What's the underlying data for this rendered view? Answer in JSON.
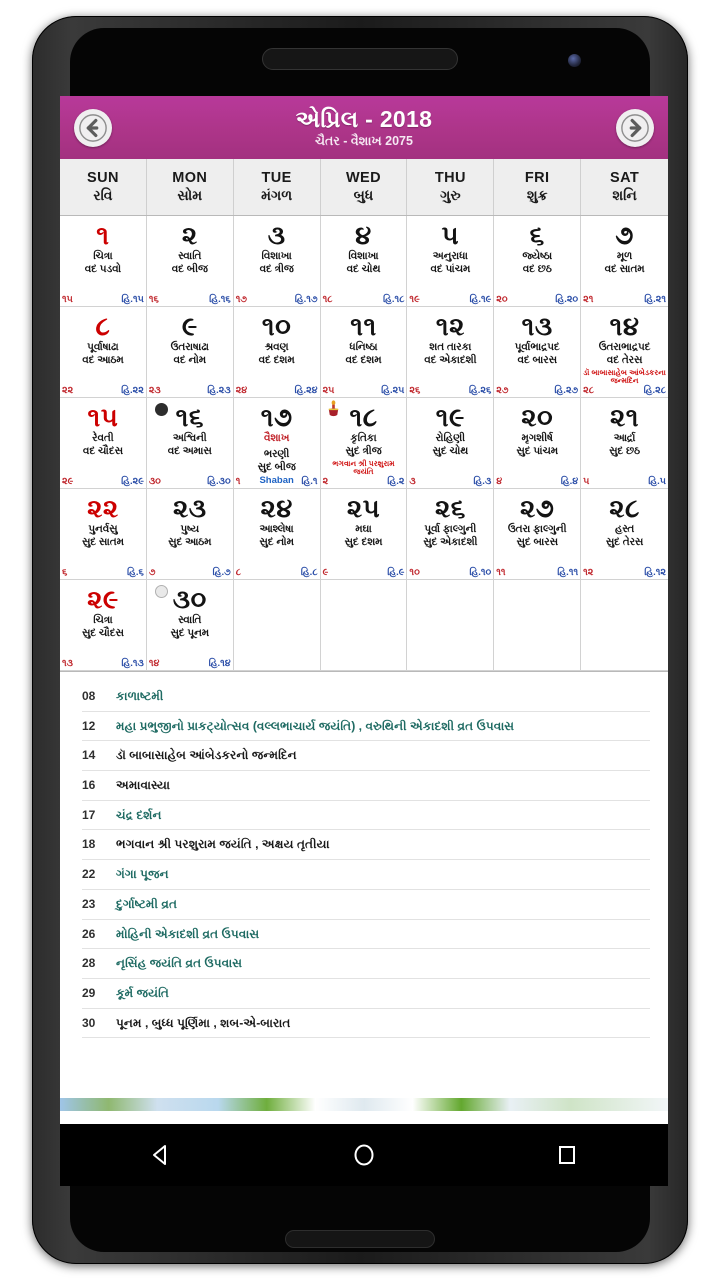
{
  "header": {
    "month_title": "એપ્રિલ - 2018",
    "subtitle": "ચૈતર - વૈશાખ 2075",
    "prev_icon": "arrow-left-circle-icon",
    "next_icon": "arrow-right-circle-icon"
  },
  "weekdays": [
    {
      "en": "SUN",
      "gu": "રવિ"
    },
    {
      "en": "MON",
      "gu": "સોમ"
    },
    {
      "en": "TUE",
      "gu": "મંગળ"
    },
    {
      "en": "WED",
      "gu": "બુધ"
    },
    {
      "en": "THU",
      "gu": "ગુરુ"
    },
    {
      "en": "FRI",
      "gu": "શુક્ર"
    },
    {
      "en": "SAT",
      "gu": "શનિ"
    }
  ],
  "days": [
    {
      "num": "૧",
      "holiday": true,
      "nakshatra": "ચિત્રા",
      "tithi": "વદ પડવો",
      "corner_left": "૧૫",
      "corner_right": "હિ.૧૫"
    },
    {
      "num": "૨",
      "holiday": false,
      "nakshatra": "સ્વાતિ",
      "tithi": "વદ બીજ",
      "corner_left": "૧૬",
      "corner_right": "હિ.૧૬"
    },
    {
      "num": "૩",
      "holiday": false,
      "nakshatra": "વિશાખા",
      "tithi": "વદ ત્રીજ",
      "corner_left": "૧૭",
      "corner_right": "હિ.૧૭"
    },
    {
      "num": "૪",
      "holiday": false,
      "nakshatra": "વિશાખા",
      "tithi": "વદ ચોથ",
      "corner_left": "૧૮",
      "corner_right": "હિ.૧૮"
    },
    {
      "num": "૫",
      "holiday": false,
      "nakshatra": "અનુરાધા",
      "tithi": "વદ પાંચમ",
      "corner_left": "૧૯",
      "corner_right": "હિ.૧૯"
    },
    {
      "num": "૬",
      "holiday": false,
      "nakshatra": "જ્યેષ્ઠા",
      "tithi": "વદ છઠ",
      "corner_left": "૨૦",
      "corner_right": "હિ.૨૦"
    },
    {
      "num": "૭",
      "holiday": false,
      "nakshatra": "મૂળ",
      "tithi": "વદ સાતમ",
      "corner_left": "૨૧",
      "corner_right": "હિ.૨૧"
    },
    {
      "num": "૮",
      "holiday": true,
      "nakshatra": "પૂર્વાષાઢા",
      "tithi": "વદ આઠમ",
      "corner_left": "૨૨",
      "corner_right": "હિ.૨૨"
    },
    {
      "num": "૯",
      "holiday": false,
      "nakshatra": "ઉતરાષાઢા",
      "tithi": "વદ નોમ",
      "corner_left": "૨૩",
      "corner_right": "હિ.૨૩"
    },
    {
      "num": "૧૦",
      "holiday": false,
      "nakshatra": "શ્રવણ",
      "tithi": "વદ દશમ",
      "corner_left": "૨૪",
      "corner_right": "હિ.૨૪"
    },
    {
      "num": "૧૧",
      "holiday": false,
      "nakshatra": "ધનિષ્ઠા",
      "tithi": "વદ દશમ",
      "corner_left": "૨૫",
      "corner_right": "હિ.૨૫"
    },
    {
      "num": "૧૨",
      "holiday": false,
      "nakshatra": "શત તારકા",
      "tithi": "વદ એકાદશી",
      "corner_left": "૨૬",
      "corner_right": "હિ.૨૬"
    },
    {
      "num": "૧૩",
      "holiday": false,
      "nakshatra": "પૂર્વાભાદ્રપદ",
      "tithi": "વદ બારસ",
      "corner_left": "૨૭",
      "corner_right": "હિ.૨૭"
    },
    {
      "num": "૧૪",
      "holiday": false,
      "nakshatra": "ઉતરાભાદ્રપદ",
      "tithi": "વદ તેરસ",
      "note": "ડૉ બાબાસાહેબ આંબેડકરના જન્મદિન",
      "corner_left": "૨૮",
      "corner_right": "હિ.૨૮"
    },
    {
      "num": "૧૫",
      "holiday": true,
      "nakshatra": "રેવતી",
      "tithi": "વદ ચૌદસ",
      "corner_left": "૨૯",
      "corner_right": "હિ.૨૯"
    },
    {
      "num": "૧૬",
      "holiday": false,
      "nakshatra": "અશ્વિની",
      "tithi": "વદ અમાસ",
      "moon": "new-moon-icon",
      "corner_left": "૩૦",
      "corner_right": "હિ.૩૦"
    },
    {
      "num": "૧૭",
      "holiday": false,
      "month_label": "વૈશાખ",
      "nakshatra": "ભરણી",
      "tithi": "સુદ બીજ",
      "islamic": "Shaban",
      "corner_left": "૧",
      "corner_right": "હિ.૧"
    },
    {
      "num": "૧૮",
      "holiday": false,
      "nakshatra": "કૃતિકા",
      "tithi": "સુદ ત્રીજ",
      "note": "ભગવાન શ્રી પરશુરામ જયંતિ",
      "festival_icon": "kalash-icon",
      "corner_left": "૨",
      "corner_right": "હિ.૨"
    },
    {
      "num": "૧૯",
      "holiday": false,
      "nakshatra": "રોહિણી",
      "tithi": "સુદ ચોથ",
      "corner_left": "૩",
      "corner_right": "હિ.૩"
    },
    {
      "num": "૨૦",
      "holiday": false,
      "nakshatra": "મૃગશીર્ષ",
      "tithi": "સુદ પાંચમ",
      "corner_left": "૪",
      "corner_right": "હિ.૪"
    },
    {
      "num": "૨૧",
      "holiday": false,
      "nakshatra": "આર્દ્રા",
      "tithi": "સુદ છઠ",
      "corner_left": "૫",
      "corner_right": "હિ.૫"
    },
    {
      "num": "૨૨",
      "holiday": true,
      "nakshatra": "પુનર્વસુ",
      "tithi": "સુદ સાતમ",
      "corner_left": "૬",
      "corner_right": "હિ.૬"
    },
    {
      "num": "૨૩",
      "holiday": false,
      "nakshatra": "પુષ્ય",
      "tithi": "સુદ આઠમ",
      "corner_left": "૭",
      "corner_right": "હિ.૭"
    },
    {
      "num": "૨૪",
      "holiday": false,
      "nakshatra": "આશ્લેષા",
      "tithi": "સુદ નોમ",
      "corner_left": "૮",
      "corner_right": "હિ.૮"
    },
    {
      "num": "૨૫",
      "holiday": false,
      "nakshatra": "મઘા",
      "tithi": "સુદ દશમ",
      "corner_left": "૯",
      "corner_right": "હિ.૯"
    },
    {
      "num": "૨૬",
      "holiday": false,
      "nakshatra": "પૂર્વા ફાલ્ગુની",
      "tithi": "સુદ એકાદશી",
      "corner_left": "૧૦",
      "corner_right": "હિ.૧૦"
    },
    {
      "num": "૨૭",
      "holiday": false,
      "nakshatra": "ઉતરા ફાલ્ગુની",
      "tithi": "સુદ બારસ",
      "corner_left": "૧૧",
      "corner_right": "હિ.૧૧"
    },
    {
      "num": "૨૮",
      "holiday": false,
      "nakshatra": "હસ્ત",
      "tithi": "સુદ તેરસ",
      "corner_left": "૧૨",
      "corner_right": "હિ.૧૨"
    },
    {
      "num": "૨૯",
      "holiday": true,
      "nakshatra": "ચિત્રા",
      "tithi": "સુદ ચૌદસ",
      "corner_left": "૧૩",
      "corner_right": "હિ.૧૩"
    },
    {
      "num": "૩૦",
      "holiday": false,
      "nakshatra": "સ્વાતિ",
      "tithi": "સુદ પૂનમ",
      "moon": "full-moon-icon",
      "corner_left": "૧૪",
      "corner_right": "હિ.૧૪"
    }
  ],
  "events": [
    {
      "date": "08",
      "text": "કાળાષ્ટમી",
      "dark": false
    },
    {
      "date": "12",
      "text": "મહા પ્રભુજીનો પ્રાકટ્યોત્સવ (વલ્લભાચાર્ય જયંતિ) , વરુથિની એકાદશી વ્રત ઉપવાસ",
      "dark": false
    },
    {
      "date": "14",
      "text": "ડૉ બાબાસાહેબ આંબેડકરનો જન્મદિન",
      "dark": true
    },
    {
      "date": "16",
      "text": "અમાવાસ્યા",
      "dark": true
    },
    {
      "date": "17",
      "text": "ચંદ્ર દર્શન",
      "dark": false
    },
    {
      "date": "18",
      "text": "ભગવાન શ્રી પરશુરામ જયંતિ , અક્ષય તૃતીયા",
      "dark": true
    },
    {
      "date": "22",
      "text": "ગંગા પૂજન",
      "dark": false
    },
    {
      "date": "23",
      "text": "દુર્ગાષ્ટમી વ્રત",
      "dark": false
    },
    {
      "date": "26",
      "text": "મોહિની એકાદશી વ્રત ઉપવાસ",
      "dark": false
    },
    {
      "date": "28",
      "text": "નૃસિંહ જયંતિ વ્રત ઉપવાસ",
      "dark": false
    },
    {
      "date": "29",
      "text": "કૂર્મ જયંતિ",
      "dark": false
    },
    {
      "date": "30",
      "text": "પૂનમ , બુધ્ધ પૂર્ણિમા , શબ-એ-બારાત",
      "dark": true
    }
  ],
  "navbar": {
    "back_icon": "triangle-back-icon",
    "home_icon": "circle-home-icon",
    "recents_icon": "square-recents-icon"
  },
  "colors": {
    "header_bg": "#ad3589",
    "holiday_red": "#cc0000",
    "islamic_blue": "#1f63c4",
    "event_teal": "#1f6b63"
  }
}
